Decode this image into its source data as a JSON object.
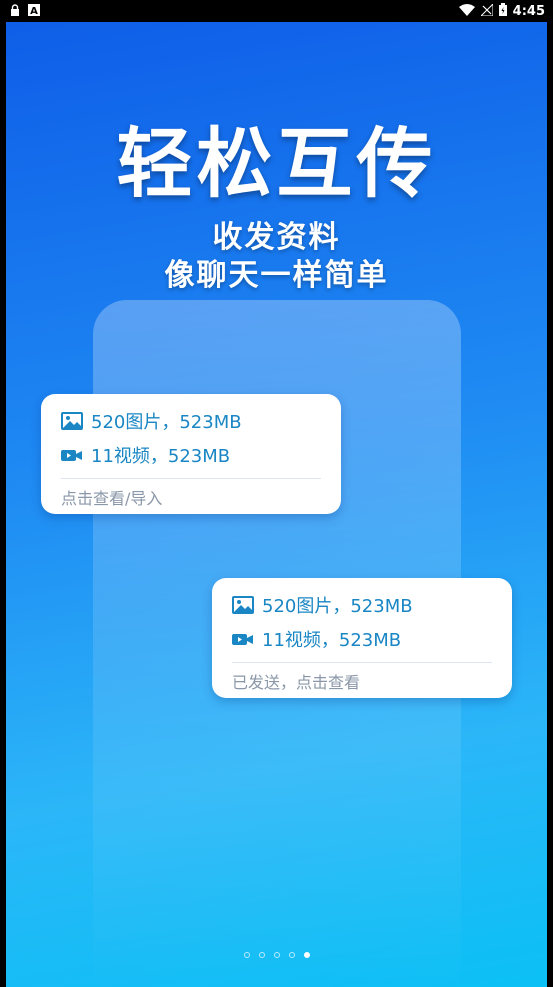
{
  "status_bar": {
    "time": "4:45",
    "icons": [
      "lock-icon",
      "a-icon",
      "wifi-icon",
      "no-signal-icon",
      "battery-icon"
    ]
  },
  "hero": {
    "title": "轻松互传",
    "subtitle_line1": "收发资料",
    "subtitle_line2": "像聊天一样简单"
  },
  "cards": [
    {
      "images_text": "520图片，523MB",
      "videos_text": "11视频，523MB",
      "action": "点击查看/导入"
    },
    {
      "images_text": "520图片，523MB",
      "videos_text": "11视频，523MB",
      "action": "已发送，点击查看"
    }
  ],
  "pager": {
    "total": 5,
    "active_index": 4
  },
  "colors": {
    "accent": "#1a86c4",
    "bg_top": "#0f5ee8",
    "bg_bottom": "#0bc0f5"
  }
}
